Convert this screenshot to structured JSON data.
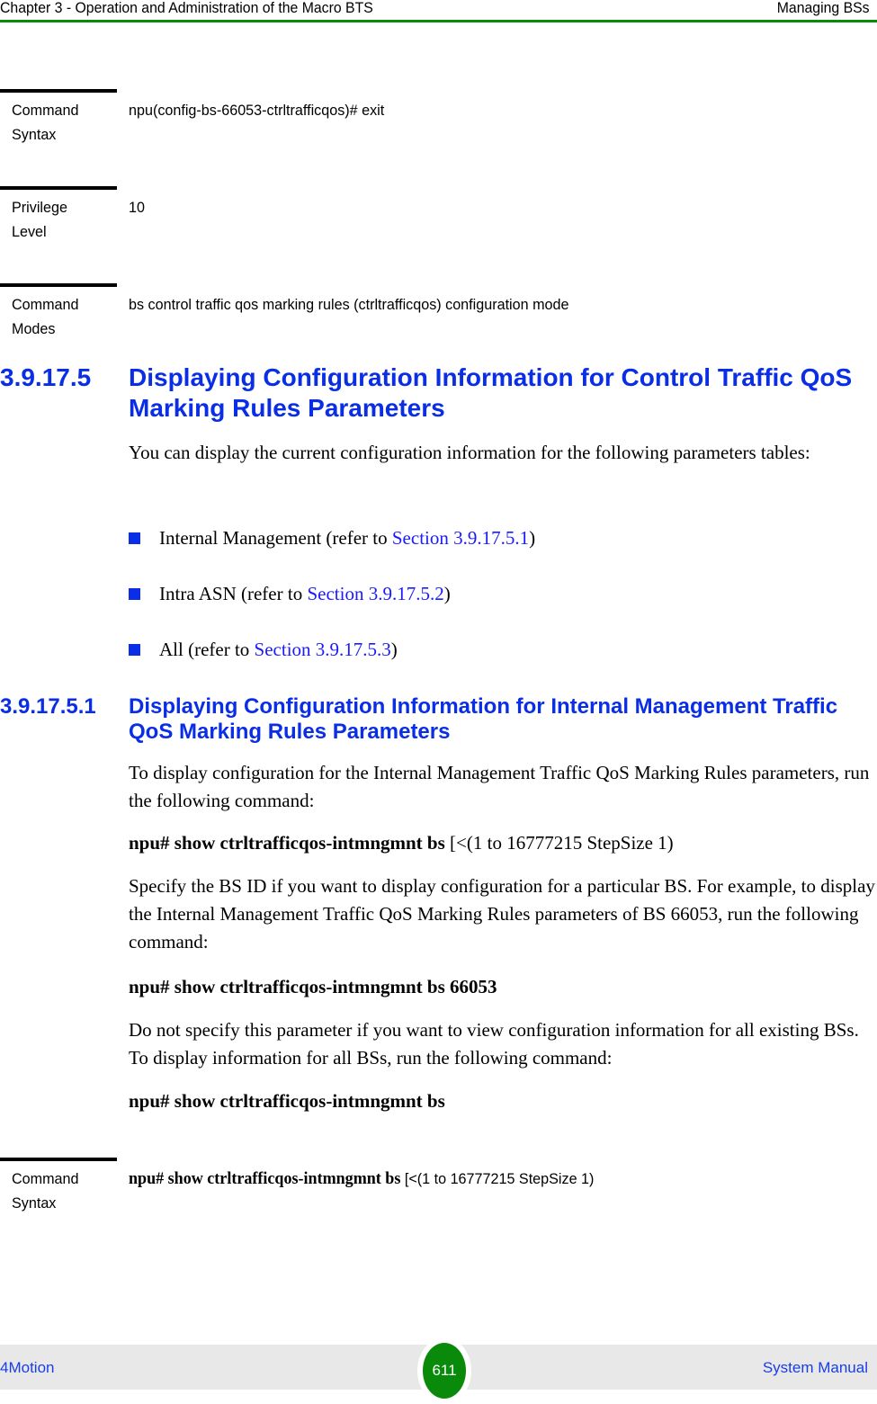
{
  "header": {
    "chapter": "Chapter 3 - Operation and Administration of the Macro BTS",
    "section": "Managing BSs"
  },
  "top_tables": [
    {
      "label_line1": "Command",
      "label_line2": "Syntax",
      "value": "npu(config-bs-66053-ctrltrafficqos)# exit"
    },
    {
      "label_line1": "Privilege",
      "label_line2": "Level",
      "value": "10"
    },
    {
      "label_line1": "Command",
      "label_line2": "Modes",
      "value": "bs control traffic qos marking rules (ctrltrafficqos) configuration mode"
    }
  ],
  "section_3_9_17_5": {
    "number": "3.9.17.5",
    "title": "Displaying Configuration Information for Control Traffic QoS Marking Rules Parameters",
    "intro": "You can display the current configuration information for the following parameters tables:",
    "bullets": [
      {
        "text": "Internal Management (refer to ",
        "link": "Section 3.9.17.5.1",
        "suffix": ")"
      },
      {
        "text": "Intra ASN (refer to ",
        "link": "Section 3.9.17.5.2",
        "suffix": ")"
      },
      {
        "text": "All (refer to ",
        "link": "Section 3.9.17.5.3",
        "suffix": ")"
      }
    ]
  },
  "section_3_9_17_5_1": {
    "number": "3.9.17.5.1",
    "title": "Displaying Configuration Information for Internal Management Traffic QoS Marking Rules Parameters",
    "intro": "To display configuration for the Internal Management Traffic QoS Marking Rules parameters, run the following command:",
    "cmd1_bold": "npu# show ctrltrafficqos-intmngmnt bs",
    "cmd1_rest": " [<(1 to 16777215 StepSize 1)",
    "para2": "Specify the BS ID if you want to display configuration for a particular BS. For example, to display the Internal Management Traffic QoS Marking Rules parameters of BS 66053, run the following command:",
    "cmd2": "npu# show ctrltrafficqos-intmngmnt bs 66053",
    "para3": "Do not specify this parameter if you want to view configuration information for all existing BSs. To display information for all BSs, run the following command:",
    "cmd3": "npu# show ctrltrafficqos-intmngmnt bs"
  },
  "bottom_table": {
    "label_line1": "Command",
    "label_line2": "Syntax",
    "value_bold": "npu# show ctrltrafficqos-intmngmnt bs",
    "value_rest": " [<(1 to 16777215 StepSize 1)"
  },
  "footer": {
    "product": "4Motion",
    "page_number": "611",
    "manual": "System Manual"
  },
  "colors": {
    "heading_blue": "#0a2ee6",
    "link_blue": "#1a1aff",
    "accent_green": "#0a8a0a"
  }
}
